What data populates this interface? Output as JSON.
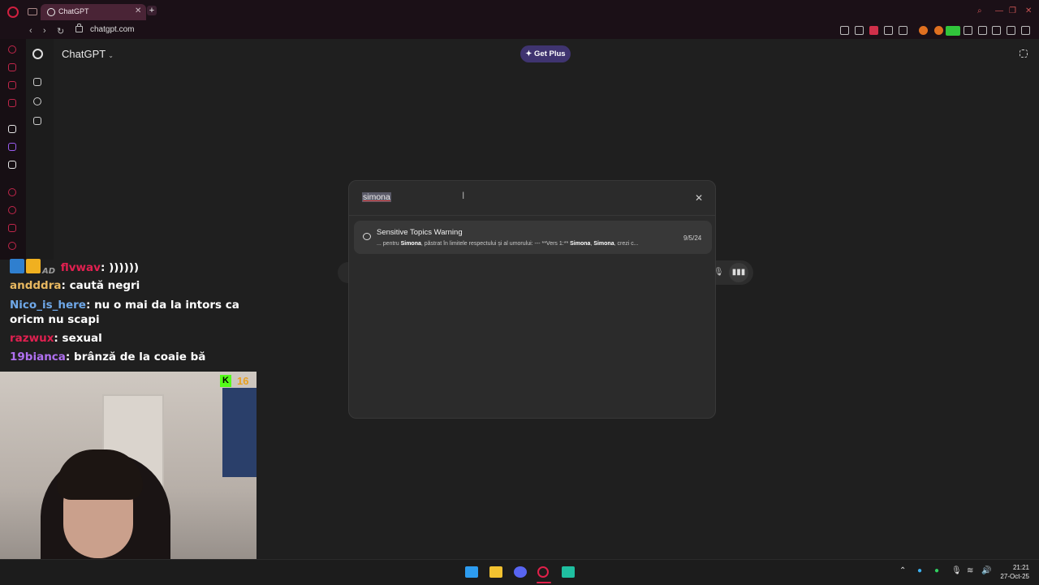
{
  "browser": {
    "tab_title": "ChatGPT",
    "url": "chatgpt.com"
  },
  "app": {
    "model_label": "ChatGPT",
    "get_plus_label": "Get Plus"
  },
  "search_modal": {
    "query": "simona",
    "results": [
      {
        "title": "Sensitive Topics Warning",
        "snippet_parts": [
          "... pentru ",
          "Simona",
          ", păstrat în limitele respectului și al umorului: --- **Vers 1:** ",
          "Simona",
          ", ",
          "Simona",
          ", crezi c..."
        ],
        "date": "9/5/24"
      }
    ]
  },
  "chat_overlay": {
    "messages": [
      {
        "user": "flvwav",
        "text": "))))))",
        "user_color": "#e02050",
        "badges": [
          "blue",
          "gold",
          "AD"
        ]
      },
      {
        "user": "andddra",
        "text": "caută negri",
        "user_color": "#e8b860"
      },
      {
        "user": "Nico_is_here",
        "text": "nu o mai da la intors ca oricm nu scapi",
        "user_color": "#6fa8e8"
      },
      {
        "user": "razwux",
        "text": "sexual",
        "user_color": "#e02050"
      },
      {
        "user": "19bianca",
        "text": "brânză de la coaie bă",
        "user_color": "#b070f0"
      }
    ]
  },
  "webcam": {
    "kick_viewers": "16"
  },
  "taskbar": {
    "time": "21:21",
    "date": "27-Oct-25"
  }
}
